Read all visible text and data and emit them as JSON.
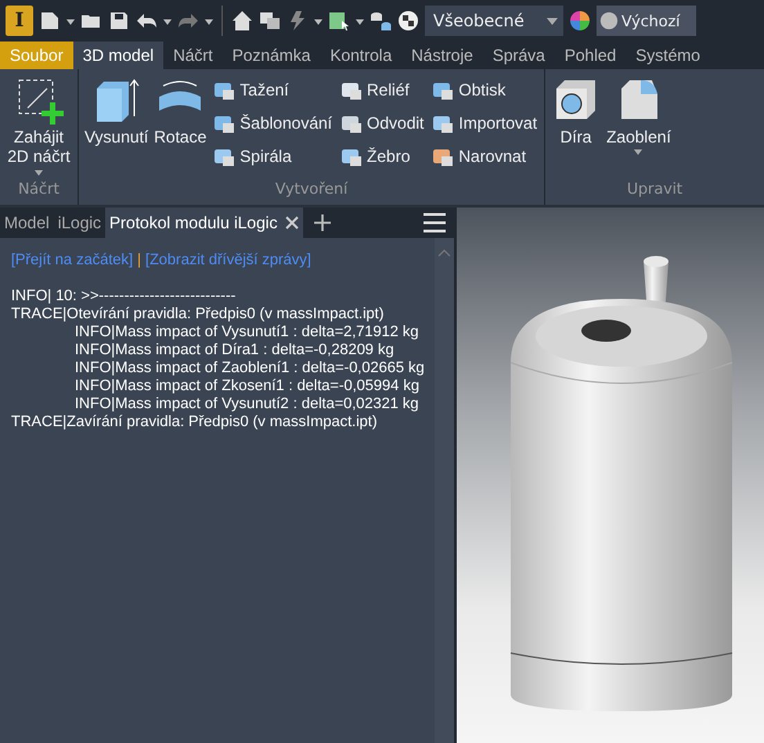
{
  "app_logo": "I",
  "quick_access": {
    "style_dropdown": "Všeobecné",
    "appearance": "Výchozí"
  },
  "menu_tabs": [
    {
      "label": "Soubor",
      "kind": "file"
    },
    {
      "label": "3D model",
      "kind": "tab",
      "selected": true
    },
    {
      "label": "Náčrt",
      "kind": "tab",
      "selected": false
    },
    {
      "label": "Poznámka",
      "kind": "tab",
      "selected": false
    },
    {
      "label": "Kontrola",
      "kind": "tab",
      "selected": false
    },
    {
      "label": "Nástroje",
      "kind": "tab",
      "selected": false
    },
    {
      "label": "Správa",
      "kind": "tab",
      "selected": false
    },
    {
      "label": "Pohled",
      "kind": "tab",
      "selected": false
    },
    {
      "label": "Systémo",
      "kind": "tab",
      "selected": false
    }
  ],
  "ribbon_groups": [
    {
      "title": "Náčrt",
      "large": [
        {
          "label": "Zahájit 2D náčrt",
          "dropdown": true
        }
      ]
    },
    {
      "title": "Vytvoření",
      "large": [
        {
          "label": "Vysunutí",
          "dropdown": false
        },
        {
          "label": "Rotace",
          "dropdown": false
        }
      ],
      "small": [
        {
          "label": "Tažení"
        },
        {
          "label": "Šablonování"
        },
        {
          "label": "Spirála"
        },
        {
          "label": "Reliéf"
        },
        {
          "label": "Odvodit"
        },
        {
          "label": "Žebro"
        },
        {
          "label": "Obtisk"
        },
        {
          "label": "Importovat"
        },
        {
          "label": "Narovnat"
        }
      ]
    },
    {
      "title": "Upravit",
      "large": [
        {
          "label": "Díra",
          "dropdown": false
        },
        {
          "label": "Zaoblení",
          "dropdown": true
        }
      ]
    }
  ],
  "panel_tabs": [
    {
      "label": "Model",
      "selected": false,
      "closable": false
    },
    {
      "label": "iLogic",
      "selected": false,
      "closable": false
    },
    {
      "label": "Protokol modulu iLogic",
      "selected": true,
      "closable": true
    }
  ],
  "log": {
    "links": [
      "[Přejít na začátek]",
      "[Zobrazit dřívější zprávy]"
    ],
    "separator": "|",
    "lines": [
      {
        "text": "INFO| 10: >>---------------------------",
        "indented": false
      },
      {
        "text": "TRACE|Otevírání pravidla: Předpis0 (v massImpact.ipt)",
        "indented": false
      },
      {
        "text": "INFO|Mass impact of Vysunutí1 : delta=2,71912 kg",
        "indented": true
      },
      {
        "text": "INFO|Mass impact of Díra1 : delta=-0,28209 kg",
        "indented": true
      },
      {
        "text": "INFO|Mass impact of Zaoblení1 : delta=-0,02665 kg",
        "indented": true
      },
      {
        "text": "INFO|Mass impact of Zkosení1 : delta=-0,05994 kg",
        "indented": true
      },
      {
        "text": "INFO|Mass impact of Vysunutí2 : delta=0,02321 kg",
        "indented": true
      },
      {
        "text": "TRACE|Zavírání pravidla: Předpis0 (v massImpact.ipt)",
        "indented": false
      }
    ]
  }
}
